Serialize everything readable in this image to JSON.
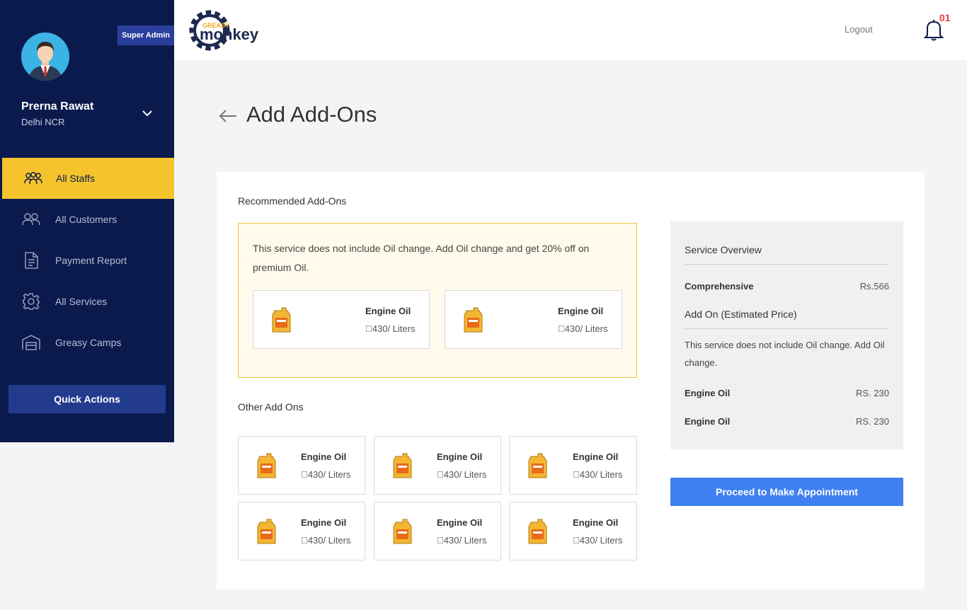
{
  "sidebar": {
    "role_badge": "Super Admin",
    "user_name": "Prerna Rawat",
    "user_location": "Delhi NCR",
    "items": [
      {
        "label": "All Staffs",
        "icon": "staff-icon",
        "active": true
      },
      {
        "label": "All Customers",
        "icon": "customers-icon",
        "active": false
      },
      {
        "label": "Payment Report",
        "icon": "document-icon",
        "active": false
      },
      {
        "label": "All Services",
        "icon": "gear-icon",
        "active": false
      },
      {
        "label": "Greasy Camps",
        "icon": "garage-icon",
        "active": false
      }
    ],
    "quick_actions": "Quick Actions"
  },
  "header": {
    "logo_top": "GREASY",
    "logo_main": "monkey",
    "logout": "Logout",
    "notification_count": "01"
  },
  "page": {
    "title": "Add Add-Ons"
  },
  "recommended": {
    "title": "Recommended Add-Ons",
    "message": "This service does not include Oil change. Add Oil change and get 20% off on premium Oil.",
    "products": [
      {
        "name": "Engine Oil",
        "price": "\u0000430/ Liters"
      },
      {
        "name": "Engine Oil",
        "price": "\u0000430/ Liters"
      }
    ]
  },
  "other": {
    "title": "Other Add Ons",
    "products": [
      {
        "name": "Engine Oil",
        "price": "\u0000430/ Liters"
      },
      {
        "name": "Engine Oil",
        "price": "\u0000430/ Liters"
      },
      {
        "name": "Engine Oil",
        "price": "\u0000430/ Liters"
      },
      {
        "name": "Engine Oil",
        "price": "\u0000430/ Liters"
      },
      {
        "name": "Engine Oil",
        "price": "\u0000430/ Liters"
      },
      {
        "name": "Engine Oil",
        "price": "\u0000430/ Liters"
      }
    ]
  },
  "overview": {
    "title": "Service Overview",
    "service_name": "Comprehensive",
    "service_price": "Rs.566",
    "addon_title": "Add On (Estimated Price)",
    "note": "This service does not include Oil change. Add Oil change.",
    "addons": [
      {
        "name": "Engine Oil",
        "price": "RS. 230"
      },
      {
        "name": "Engine Oil",
        "price": "RS. 230"
      }
    ]
  },
  "proceed_label": "Proceed to Make Appointment",
  "colors": {
    "sidebar_bg": "#0b1a4d",
    "active_item": "#f5c42c",
    "primary_button": "#3f7ff0",
    "notification": "#e53935"
  }
}
